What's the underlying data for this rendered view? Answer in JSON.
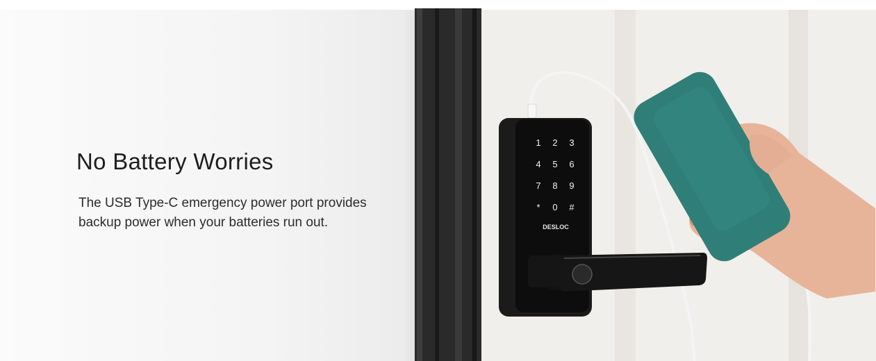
{
  "hero": {
    "heading": "No Battery Worries",
    "description": "The USB Type-C emergency power port provides backup power when your batteries run out."
  },
  "lock": {
    "brand": "DESLOC",
    "keypad": [
      "1",
      "2",
      "3",
      "4",
      "5",
      "6",
      "7",
      "8",
      "9",
      "*",
      "0",
      "#"
    ],
    "color": "#161616"
  },
  "power_bank": {
    "color": "#2f7f78"
  },
  "door": {
    "frame_color": "#2a2a2a",
    "panel_color": "#f2f0ec"
  }
}
